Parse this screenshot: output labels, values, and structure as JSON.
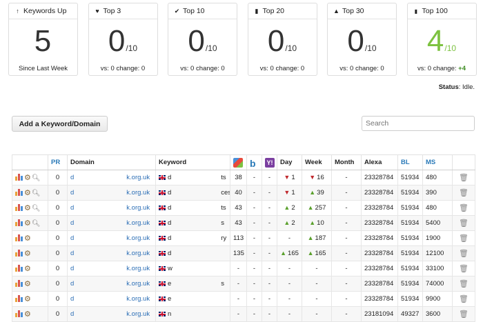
{
  "cards": [
    {
      "icon": "arrow-up-icon",
      "title": "Keywords Up",
      "value": "5",
      "denom": "",
      "sub": "Since Last Week",
      "plus": ""
    },
    {
      "icon": "heart-icon",
      "title": "Top 3",
      "value": "0",
      "denom": "/10",
      "sub": "vs: 0 change: 0",
      "plus": ""
    },
    {
      "icon": "check-icon",
      "title": "Top 10",
      "value": "0",
      "denom": "/10",
      "sub": "vs: 0 change: 0",
      "plus": ""
    },
    {
      "icon": "bookmark-icon",
      "title": "Top 20",
      "value": "0",
      "denom": "/10",
      "sub": "vs: 0 change: 0",
      "plus": ""
    },
    {
      "icon": "road-icon",
      "title": "Top 30",
      "value": "0",
      "denom": "/10",
      "sub": "vs: 0 change: 0",
      "plus": ""
    },
    {
      "icon": "signal-icon",
      "title": "Top 100",
      "value": "4",
      "denom": "/10",
      "sub": "vs: 0 change: ",
      "plus": "+4"
    }
  ],
  "status": {
    "label": "Status",
    "value": "Idle."
  },
  "add_button": "Add a Keyword/Domain",
  "search_placeholder": "Search",
  "columns": [
    "",
    "PR",
    "Domain",
    "Keyword",
    "",
    "",
    "",
    "Day",
    "Week",
    "Month",
    "Alexa",
    "BL",
    "MS",
    ""
  ],
  "rows": [
    {
      "pr": "0",
      "d1": "d",
      "d2": "k.org.uk",
      "k1": "d",
      "k2": "ts",
      "g": "38",
      "b": "-",
      "y": "-",
      "day": "1",
      "dayDir": "dn",
      "week": "16",
      "weekDir": "dn",
      "month": "-",
      "alexa": "23328784",
      "bl": "51934",
      "ms": "480",
      "mag": true
    },
    {
      "pr": "0",
      "d1": "d",
      "d2": "k.org.uk",
      "k1": "d",
      "k2": "ces",
      "g": "40",
      "b": "-",
      "y": "-",
      "day": "1",
      "dayDir": "dn",
      "week": "39",
      "weekDir": "up",
      "month": "-",
      "alexa": "23328784",
      "bl": "51934",
      "ms": "390",
      "mag": true
    },
    {
      "pr": "0",
      "d1": "d",
      "d2": "k.org.uk",
      "k1": "d",
      "k2": "ts",
      "g": "43",
      "b": "-",
      "y": "-",
      "day": "2",
      "dayDir": "up",
      "week": "257",
      "weekDir": "up",
      "month": "-",
      "alexa": "23328784",
      "bl": "51934",
      "ms": "480",
      "mag": true
    },
    {
      "pr": "0",
      "d1": "d",
      "d2": "k.org.uk",
      "k1": "d",
      "k2": "s",
      "g": "43",
      "b": "-",
      "y": "-",
      "day": "2",
      "dayDir": "up",
      "week": "10",
      "weekDir": "up",
      "month": "-",
      "alexa": "23328784",
      "bl": "51934",
      "ms": "5400",
      "mag": true
    },
    {
      "pr": "0",
      "d1": "d",
      "d2": "k.org.uk",
      "k1": "d",
      "k2": "ry",
      "g": "113",
      "b": "-",
      "y": "-",
      "day": "-",
      "dayDir": "",
      "week": "187",
      "weekDir": "up",
      "month": "-",
      "alexa": "23328784",
      "bl": "51934",
      "ms": "1900",
      "mag": false
    },
    {
      "pr": "0",
      "d1": "d",
      "d2": "k.org.uk",
      "k1": "d",
      "k2": "",
      "g": "135",
      "b": "-",
      "y": "-",
      "day": "165",
      "dayDir": "up",
      "week": "165",
      "weekDir": "up",
      "month": "-",
      "alexa": "23328784",
      "bl": "51934",
      "ms": "12100",
      "mag": false
    },
    {
      "pr": "0",
      "d1": "d",
      "d2": "k.org.uk",
      "k1": "w",
      "k2": "",
      "g": "-",
      "b": "-",
      "y": "-",
      "day": "-",
      "dayDir": "",
      "week": "-",
      "weekDir": "",
      "month": "-",
      "alexa": "23328784",
      "bl": "51934",
      "ms": "33100",
      "mag": false
    },
    {
      "pr": "0",
      "d1": "d",
      "d2": "k.org.uk",
      "k1": "e",
      "k2": "s",
      "g": "-",
      "b": "-",
      "y": "-",
      "day": "-",
      "dayDir": "",
      "week": "-",
      "weekDir": "",
      "month": "-",
      "alexa": "23328784",
      "bl": "51934",
      "ms": "74000",
      "mag": false
    },
    {
      "pr": "0",
      "d1": "d",
      "d2": "k.org.uk",
      "k1": "e",
      "k2": "",
      "g": "-",
      "b": "-",
      "y": "-",
      "day": "-",
      "dayDir": "",
      "week": "-",
      "weekDir": "",
      "month": "-",
      "alexa": "23328784",
      "bl": "51934",
      "ms": "9900",
      "mag": false
    },
    {
      "pr": "0",
      "d1": "d",
      "d2": "k.org.uk",
      "k1": "n",
      "k2": "",
      "g": "-",
      "b": "-",
      "y": "-",
      "day": "-",
      "dayDir": "",
      "week": "-",
      "weekDir": "",
      "month": "-",
      "alexa": "23181094",
      "bl": "49327",
      "ms": "3600",
      "mag": false
    }
  ],
  "colors": {
    "accent": "#2a7ab8",
    "green": "#7dc241",
    "red": "#c0282d"
  }
}
